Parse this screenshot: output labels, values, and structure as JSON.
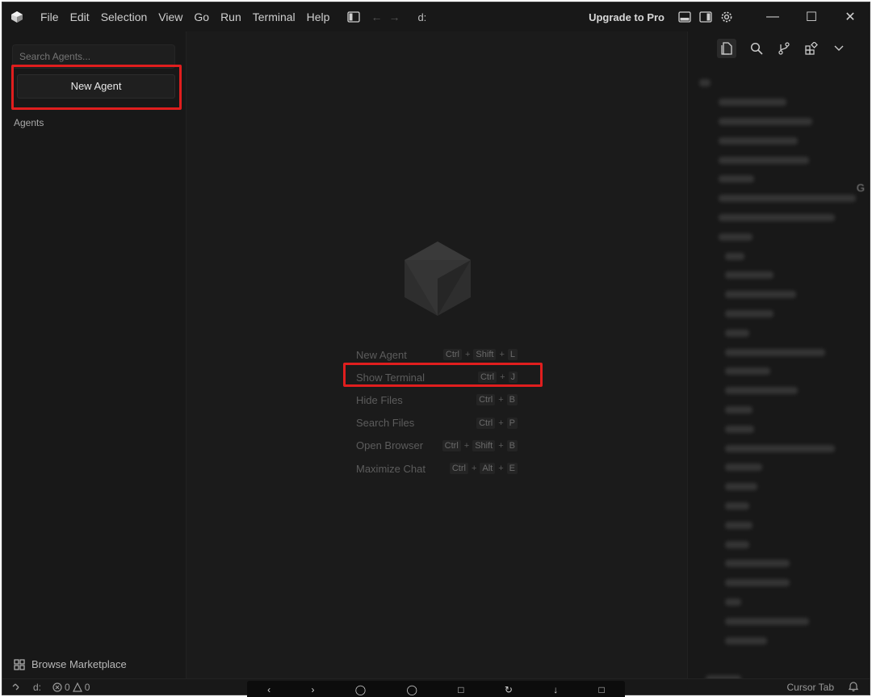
{
  "titlebar": {
    "menu": [
      "File",
      "Edit",
      "Selection",
      "View",
      "Go",
      "Run",
      "Terminal",
      "Help"
    ],
    "drive": "d:",
    "upgrade_label": "Upgrade to Pro",
    "icons": [
      "app-logo-icon",
      "toggle-primary-sidebar-icon",
      "back-arrow-icon",
      "forward-arrow-icon",
      "toggle-panel-icon",
      "toggle-secondary-sidebar-icon",
      "settings-gear-icon",
      "minimize-icon",
      "maximize-icon",
      "close-icon"
    ]
  },
  "sidebar_left": {
    "search_placeholder": "Search Agents...",
    "new_agent_label": "New Agent",
    "agents_heading": "Agents",
    "browse_marketplace_label": "Browse Marketplace"
  },
  "shortcuts": [
    {
      "label": "New Agent",
      "keys": [
        "Ctrl",
        "Shift",
        "L"
      ]
    },
    {
      "label": "Show Terminal",
      "keys": [
        "Ctrl",
        "J"
      ]
    },
    {
      "label": "Hide Files",
      "keys": [
        "Ctrl",
        "B"
      ]
    },
    {
      "label": "Search Files",
      "keys": [
        "Ctrl",
        "P"
      ]
    },
    {
      "label": "Open Browser",
      "keys": [
        "Ctrl",
        "Shift",
        "B"
      ]
    },
    {
      "label": "Maximize Chat",
      "keys": [
        "Ctrl",
        "Alt",
        "E"
      ]
    }
  ],
  "sidebar_right": {
    "tabs": [
      "files-icon",
      "search-icon",
      "source-control-icon",
      "extensions-icon",
      "chevron-down-icon"
    ],
    "tree_trailing_char": "G"
  },
  "statusbar": {
    "drive": "d:",
    "errors": "0",
    "warnings": "0",
    "cursor_tab": "Cursor Tab"
  },
  "colors": {
    "highlight": "#e01e1e",
    "window_bg": "#1b1b1b",
    "sidebar_bg": "#181818"
  }
}
